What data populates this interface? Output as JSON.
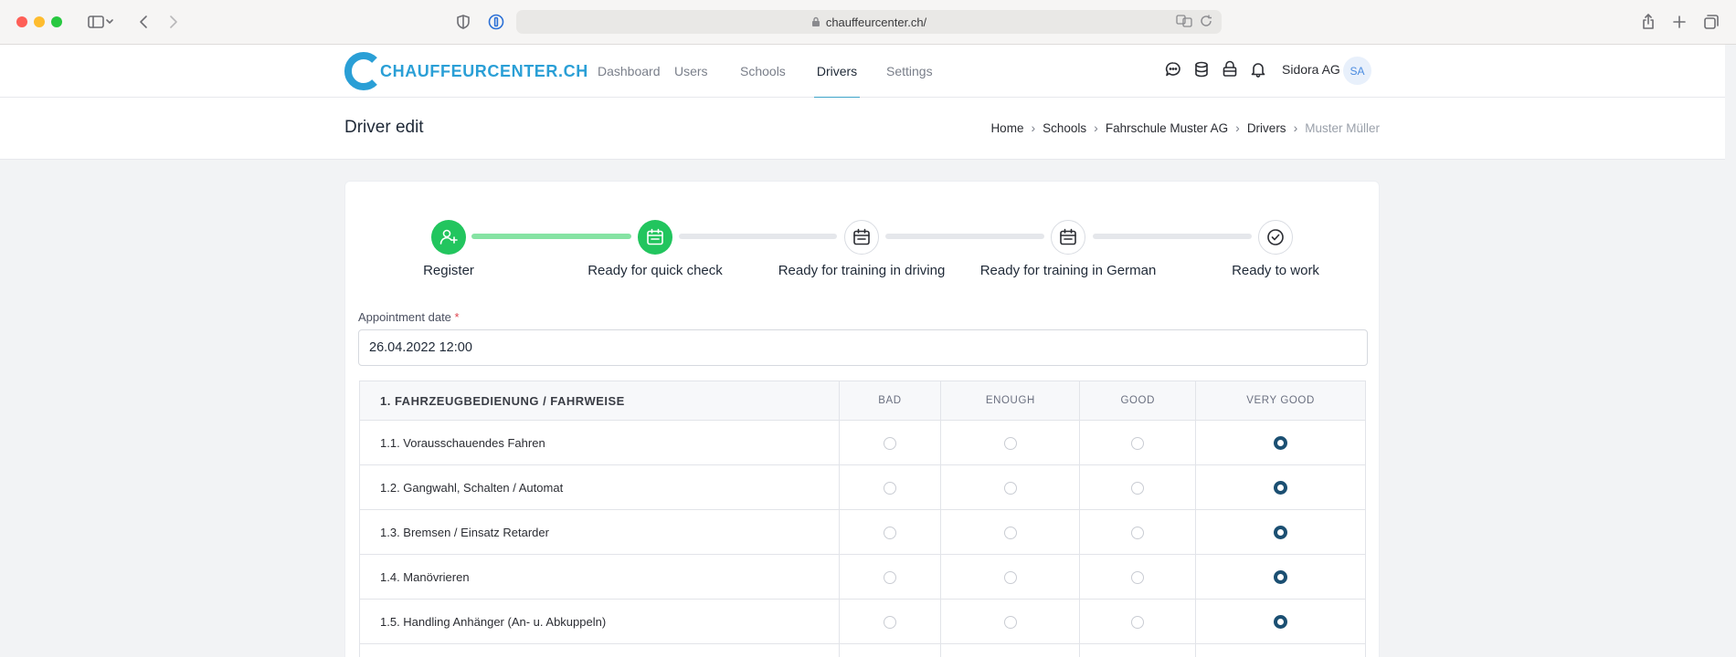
{
  "browser": {
    "url": "chauffeurcenter.ch/"
  },
  "header": {
    "logo_text": "CHAUFFEURCENTER.CH",
    "nav": [
      {
        "label": "Dashboard",
        "active": false
      },
      {
        "label": "Users",
        "active": false
      },
      {
        "label": "Schools",
        "active": false
      },
      {
        "label": "Drivers",
        "active": true
      },
      {
        "label": "Settings",
        "active": false
      }
    ],
    "icons": [
      "chat-icon",
      "database-icon",
      "lock-bag-icon",
      "bell-icon"
    ],
    "org_name": "Sidora AG",
    "avatar_initials": "SA"
  },
  "page": {
    "title": "Driver edit",
    "breadcrumb": [
      "Home",
      "Schools",
      "Fahrschule Muster AG",
      "Drivers",
      "Muster Müller"
    ]
  },
  "stepper": {
    "steps": [
      {
        "label": "Register",
        "status": "done",
        "icon": "user-plus-icon"
      },
      {
        "label": "Ready for quick check",
        "status": "done",
        "icon": "calendar-icon"
      },
      {
        "label": "Ready for training in driving",
        "status": "pending",
        "icon": "calendar-icon"
      },
      {
        "label": "Ready for training in German",
        "status": "pending",
        "icon": "calendar-icon"
      },
      {
        "label": "Ready to work",
        "status": "pending",
        "icon": "check-circle-icon"
      }
    ]
  },
  "form": {
    "appointment_label": "Appointment date",
    "required_mark": "*",
    "appointment_value": "26.04.2022 12:00"
  },
  "rating": {
    "section_title": "1. FAHRZEUGBEDIENUNG / FAHRWEISE",
    "columns": [
      "BAD",
      "ENOUGH",
      "GOOD",
      "VERY GOOD"
    ],
    "rows": [
      {
        "label": "1.1. Vorausschauendes Fahren",
        "selected": "VERY GOOD"
      },
      {
        "label": "1.2. Gangwahl, Schalten / Automat",
        "selected": "VERY GOOD"
      },
      {
        "label": "1.3. Bremsen / Einsatz Retarder",
        "selected": "VERY GOOD"
      },
      {
        "label": "1.4. Manövrieren",
        "selected": "VERY GOOD"
      },
      {
        "label": "1.5. Handling Anhänger (An- u. Abkuppeln)",
        "selected": "VERY GOOD"
      }
    ]
  },
  "colors": {
    "accent": "#3da3c9",
    "step_done": "#22c55e",
    "step_line_done": "#86e3a3",
    "radio_selected": "#1b4f72"
  }
}
